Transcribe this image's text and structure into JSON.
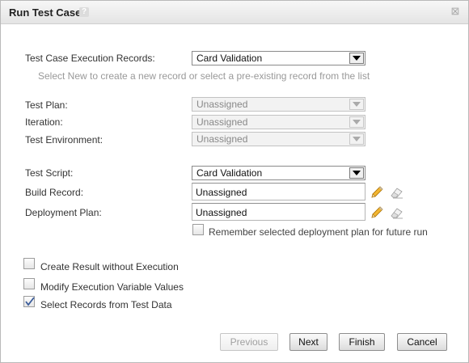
{
  "dialog": {
    "title": "Run Test Case",
    "help_icon": "question-icon",
    "close_icon": "close-icon"
  },
  "fields": {
    "execution_records": {
      "label": "Test Case Execution Records:",
      "value": "Card Validation"
    },
    "hint": "Select New to create a new record or select a pre-existing record from the list",
    "test_plan": {
      "label": "Test Plan:",
      "value": "Unassigned"
    },
    "iteration": {
      "label": "Iteration:",
      "value": "Unassigned"
    },
    "test_environment": {
      "label": "Test Environment:",
      "value": "Unassigned"
    },
    "test_script": {
      "label": "Test Script:",
      "value": "Card Validation"
    },
    "build_record": {
      "label": "Build Record:",
      "value": "Unassigned"
    },
    "deployment_plan": {
      "label": "Deployment Plan:",
      "value": "Unassigned"
    }
  },
  "options": {
    "remember_deployment": {
      "label": "Remember selected deployment plan for future run",
      "checked": false
    },
    "create_without_execution": {
      "label": "Create Result without Execution",
      "checked": false
    },
    "modify_variables": {
      "label": "Modify Execution Variable Values",
      "checked": false
    },
    "select_from_test_data": {
      "label": "Select Records from Test Data",
      "checked": true
    }
  },
  "buttons": {
    "previous": "Previous",
    "next": "Next",
    "finish": "Finish",
    "cancel": "Cancel"
  },
  "icons": {
    "edit": "pencil-icon",
    "clear": "eraser-icon"
  }
}
